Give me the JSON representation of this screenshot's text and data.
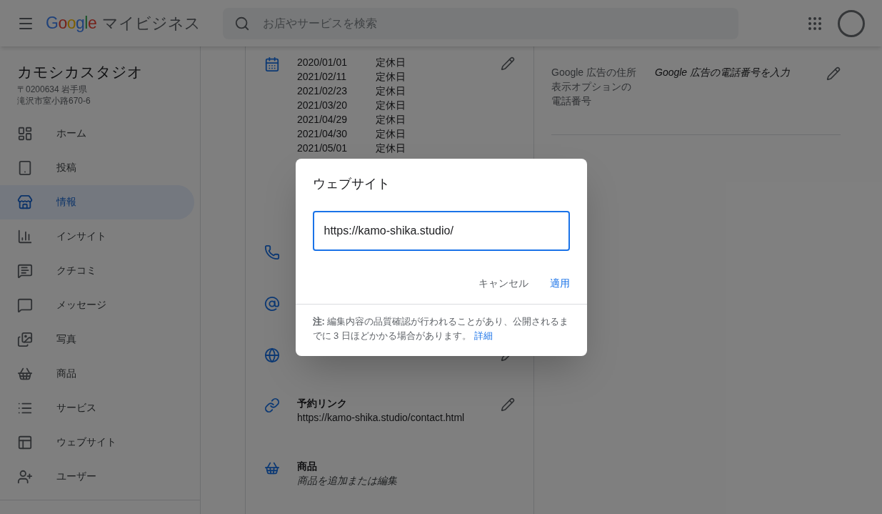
{
  "header": {
    "logo": "Google",
    "product": "マイビジネス",
    "search": {
      "placeholder": "お店やサービスを検索"
    }
  },
  "sidebar": {
    "business_name": "カモシカスタジオ",
    "address": [
      "〒0200634 岩手県",
      "滝沢市室小路670-6"
    ],
    "items": [
      {
        "label": "ホーム",
        "selected": false
      },
      {
        "label": "投稿",
        "selected": false
      },
      {
        "label": "情報",
        "selected": true
      },
      {
        "label": "インサイト",
        "selected": false
      },
      {
        "label": "クチコミ",
        "selected": false
      },
      {
        "label": "メッセージ",
        "selected": false
      },
      {
        "label": "写真",
        "selected": false
      },
      {
        "label": "商品",
        "selected": false
      },
      {
        "label": "サービス",
        "selected": false
      },
      {
        "label": "ウェブサイト",
        "selected": false
      },
      {
        "label": "ユーザー",
        "selected": false
      }
    ]
  },
  "main": {
    "special_hours": [
      {
        "date": "2020/01/01",
        "status": "定休日"
      },
      {
        "date": "2021/02/11",
        "status": "定休日"
      },
      {
        "date": "2021/02/23",
        "status": "定休日"
      },
      {
        "date": "2021/03/20",
        "status": "定休日"
      },
      {
        "date": "2021/04/29",
        "status": "定休日"
      },
      {
        "date": "2021/04/30",
        "status": "定休日"
      },
      {
        "date": "2021/05/01",
        "status": "定休日"
      }
    ],
    "sections": [
      {
        "kind": "phone"
      },
      {
        "kind": "email"
      },
      {
        "kind": "website",
        "editable": true
      },
      {
        "kind": "link",
        "title": "予約リンク",
        "value": "https://kamo-shika.studio/contact.html",
        "editable": true
      },
      {
        "kind": "products",
        "title": "商品",
        "hint": "商品を追加または編集",
        "editable": false
      }
    ]
  },
  "right_panel": {
    "label": "Google 広告の住所表示オプションの電話番号",
    "hint": "Google 広告の電話番号を入力"
  },
  "dialog": {
    "title": "ウェブサイト",
    "value": "https://kamo-shika.studio/",
    "buttons": [
      {
        "label": "キャンセル",
        "kind": "secondary"
      },
      {
        "label": "適用",
        "kind": "primary"
      }
    ],
    "note": "**注:** 編集内容の品質確認が行われることがあり、公開されるまでに 3 日ほどかかる場合があります。",
    "note_link": "詳細"
  }
}
